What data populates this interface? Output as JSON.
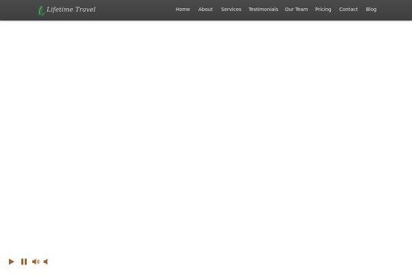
{
  "brand": {
    "logo_text": "Lifetime Travel",
    "icon": "leaf-logo-icon"
  },
  "nav": {
    "items": [
      {
        "label": "Home"
      },
      {
        "label": "About"
      },
      {
        "label": "Services"
      },
      {
        "label": "Testimonials"
      },
      {
        "label": "Our Team"
      },
      {
        "label": "Pricing"
      },
      {
        "label": "Contact"
      },
      {
        "label": "Blog"
      }
    ]
  },
  "player": {
    "controls": [
      "play-icon",
      "pause-icon",
      "volume-up-icon",
      "volume-down-icon"
    ],
    "accent": "#a0622a"
  },
  "colors": {
    "header_bg": "#454545",
    "nav_text": "#e8e8e8",
    "page_bg": "#ffffff"
  }
}
